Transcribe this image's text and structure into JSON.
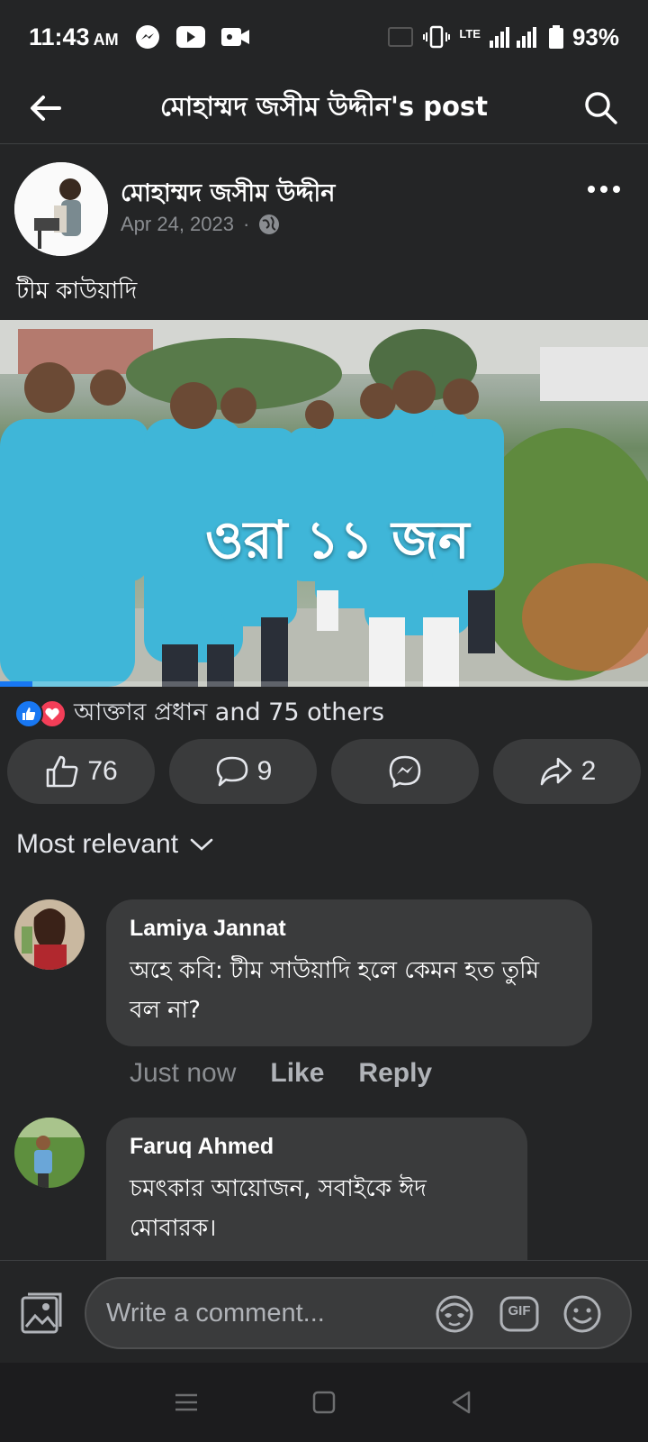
{
  "status_bar": {
    "time": "11:43",
    "ampm": "AM",
    "network": "LTE",
    "battery": "93%"
  },
  "header": {
    "title": "মোহাম্মদ জসীম উদ্দীন's post"
  },
  "post": {
    "author": "মোহাম্মদ জসীম উদ্দীন",
    "date": "Apr 24, 2023",
    "separator": "·",
    "text": "টীম কাউয়াদি",
    "media_overlay_text": "ওরা ১১ জন",
    "video_progress": 0.05,
    "reaction_summary": "আক্তার প্রধান and 75 others",
    "actions": {
      "like_count": "76",
      "comment_count": "9",
      "share_count": "2"
    }
  },
  "comments_sort": "Most relevant",
  "comments": [
    {
      "name": "Lamiya Jannat",
      "text": "অহে কবি: টীম সাউয়াদি হলে কেমন হত তুমি বল না?",
      "time": "Just now",
      "like": "Like",
      "reply": "Reply"
    },
    {
      "name": "Faruq Ahmed",
      "text": "চমৎকার আয়োজন,  সবাইকে ঈদ মোবারক।"
    }
  ],
  "composer": {
    "placeholder": "Write a comment...",
    "gif_label": "GIF"
  },
  "colors": {
    "background": "#242526",
    "surface": "#3a3b3c",
    "accent": "#1877f2",
    "love": "#f33e58",
    "muted": "#8a8d91"
  },
  "icons": {
    "back": "arrow-left-icon",
    "search": "search-icon",
    "more": "more-dots-icon",
    "like": "thumbs-up-icon",
    "comment": "comment-bubble-icon",
    "messenger": "messenger-icon",
    "share": "share-arrow-icon",
    "photo": "photo-icon",
    "avatar_sticker": "avatar-sticker-icon",
    "emoji": "emoji-icon"
  }
}
